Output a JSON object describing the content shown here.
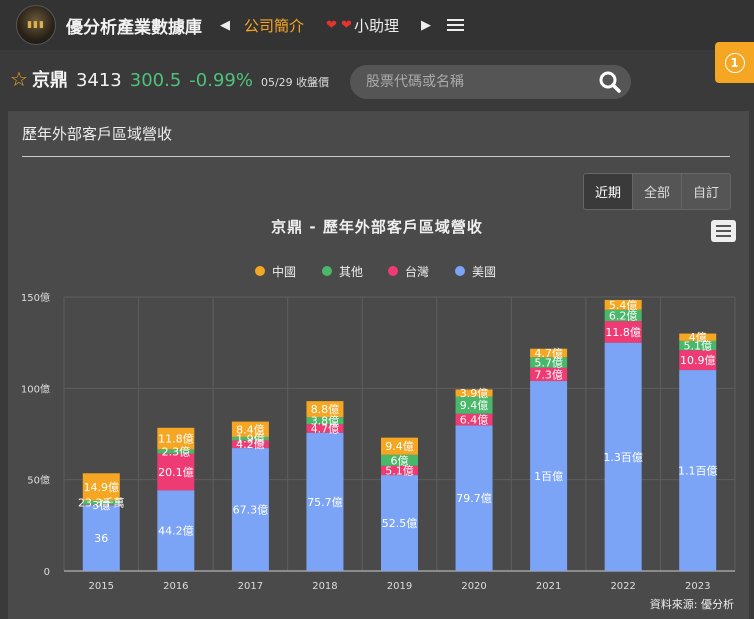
{
  "header": {
    "site_title": "優分析產業數據庫",
    "nav_link": "公司簡介",
    "helper": "小助理",
    "notification_count": "1"
  },
  "quote": {
    "name": "京鼎",
    "code": "3413",
    "price": "300.5",
    "change": "-0.99%",
    "date_label": "05/29 收盤價"
  },
  "search": {
    "placeholder": "股票代碼或名稱"
  },
  "panel": {
    "title": "歷年外部客戶區域營收",
    "range_buttons": [
      "近期",
      "全部",
      "自訂"
    ]
  },
  "chart_data": {
    "type": "bar",
    "stacked": true,
    "title": "京鼎 - 歷年外部客戶區域營收",
    "categories": [
      "2015",
      "2016",
      "2017",
      "2018",
      "2019",
      "2020",
      "2021",
      "2022",
      "2023"
    ],
    "ylim": [
      0,
      150
    ],
    "yticks": [
      "0",
      "50億",
      "100億",
      "150億"
    ],
    "grid": true,
    "legend": "top",
    "legend_order": [
      "中國",
      "其他",
      "台灣",
      "美國"
    ],
    "series": [
      {
        "name": "美國",
        "color": "#7ba4f7",
        "values": [
          36,
          44.2,
          67.3,
          75.7,
          52.5,
          79.7,
          104,
          125,
          110
        ],
        "labels": [
          "36",
          "44.2億",
          "67.3億",
          "75.7億",
          "52.5億",
          "79.7億",
          "1百億",
          "1.3百億",
          "1.1百億"
        ]
      },
      {
        "name": "台灣",
        "color": "#ee3b74",
        "values": [
          0.3,
          20.1,
          4.2,
          4.7,
          5.1,
          6.4,
          7.3,
          11.8,
          10.9
        ],
        "labels": [
          "3億",
          "20.1億",
          "4.2億",
          "4.7億",
          "5.1億",
          "6.4億",
          "7.3億",
          "11.8億",
          "10.9億"
        ]
      },
      {
        "name": "其他",
        "color": "#4ab86a",
        "values": [
          2.3,
          2.3,
          1.9,
          3.8,
          6,
          9.4,
          5.7,
          6.2,
          5.1
        ],
        "labels": [
          "23.3千萬",
          "2.3億",
          "1.9億",
          "3.8億",
          "6億",
          "9.4億",
          "5.7億",
          "6.2億",
          "5.1億"
        ]
      },
      {
        "name": "中國",
        "color": "#f5a623",
        "values": [
          14.9,
          11.8,
          8.4,
          8.8,
          9.4,
          3.9,
          4.7,
          5.4,
          4
        ],
        "labels": [
          "14.9億",
          "11.8億",
          "8.4億",
          "8.8億",
          "9.4億",
          "3.9億",
          "4.7億",
          "5.4億",
          "4億"
        ]
      }
    ],
    "credit": "資料來源: 優分析"
  }
}
